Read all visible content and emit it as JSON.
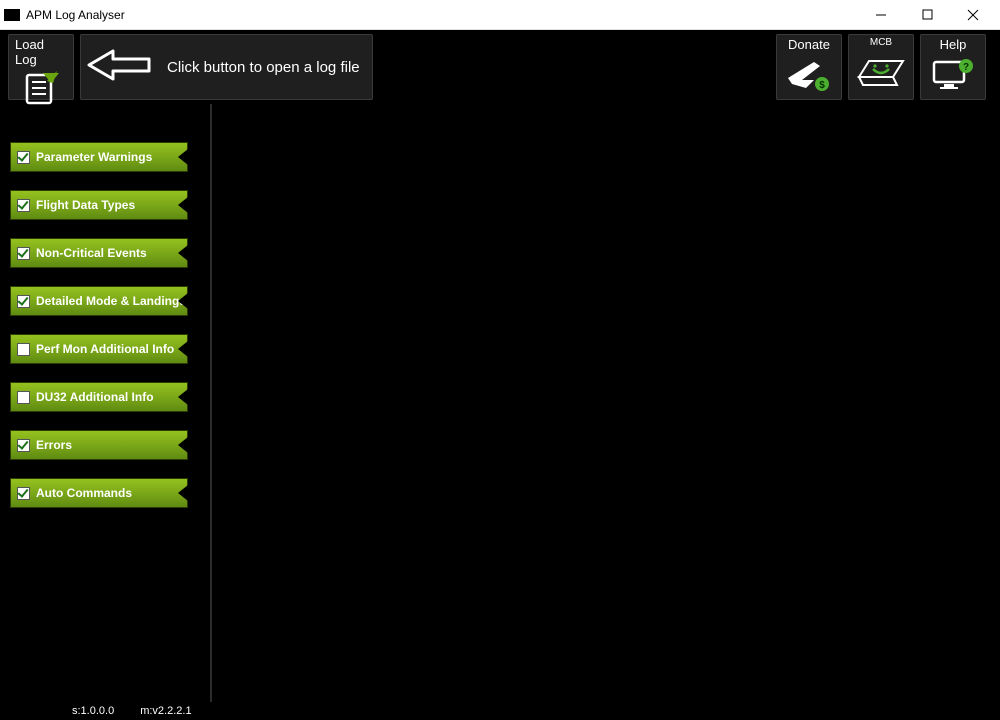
{
  "window": {
    "title": "APM Log Analyser"
  },
  "toolbar": {
    "load_log": "Load Log",
    "hint": "Click button to open a log file",
    "donate": "Donate",
    "mcb": "MCB",
    "help": "Help"
  },
  "sidebar": {
    "items": [
      {
        "label": "Parameter Warnings",
        "checked": true
      },
      {
        "label": "Flight Data Types",
        "checked": true
      },
      {
        "label": "Non-Critical Events",
        "checked": true
      },
      {
        "label": "Detailed Mode & Landings",
        "checked": true
      },
      {
        "label": "Perf Mon Additional Info",
        "checked": false
      },
      {
        "label": "DU32 Additional Info",
        "checked": false
      },
      {
        "label": "Errors",
        "checked": true
      },
      {
        "label": "Auto Commands",
        "checked": true
      }
    ]
  },
  "status": {
    "s": "s:1.0.0.0",
    "m": "m:v2.2.2.1"
  }
}
